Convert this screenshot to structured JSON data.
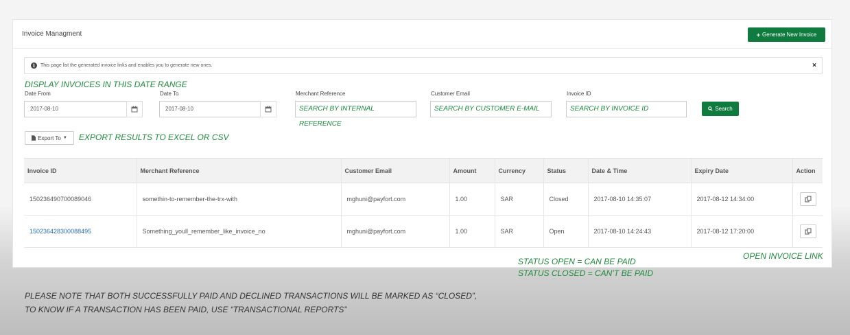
{
  "header": {
    "title": "Invoice Managment",
    "generate_button": "Generate New Invoice"
  },
  "info": {
    "text": "This page list the generated invoice links and enables you to generate new ones.",
    "close": "×"
  },
  "filters": {
    "annotation": "DISPLAY INVOICES IN THIS DATE RANGE",
    "date_from_label": "Date From",
    "date_from_value": "2017-08-10",
    "date_to_label": "Date To",
    "date_to_value": "2017-08-10",
    "merchant_ref_label": "Merchant Reference",
    "merchant_ref_hint": "SEARCH BY INTERNAL REFERENCE",
    "email_label": "Customer Email",
    "email_hint": "SEARCH BY CUSTOMER E-MAIL",
    "invoice_id_label": "Invoice ID",
    "invoice_id_hint": "SEARCH BY INVOICE ID",
    "search_button": "Search"
  },
  "export": {
    "button": "Export To",
    "annotation": "EXPORT RESULTS TO EXCEL OR CSV"
  },
  "table": {
    "headers": [
      "Invoice ID",
      "Merchant Reference",
      "Customer Email",
      "Amount",
      "Currency",
      "Status",
      "Date & Time",
      "Expiry Date",
      "Action"
    ],
    "rows": [
      {
        "invoice_id": "150236490700089046",
        "merchant_ref": "somethin-to-remember-the-trx-with",
        "email": "mghuni@payfort.com",
        "amount": "1.00",
        "currency": "SAR",
        "status": "Closed",
        "datetime": "2017-08-10 14:35:07",
        "expiry": "2017-08-12 14:34:00"
      },
      {
        "invoice_id": "150236428300088495",
        "merchant_ref": "Something_youll_remember_like_invoice_no",
        "email": "mghuni@payfort.com",
        "amount": "1.00",
        "currency": "SAR",
        "status": "Open",
        "datetime": "2017-08-10 14:24:43",
        "expiry": "2017-08-12 17:20:00"
      }
    ]
  },
  "annotations": {
    "status_open": "STATUS OPEN = CAN BE PAID",
    "status_closed": "STATUS CLOSED = CAN’T BE PAID",
    "open_link": "OPEN INVOICE LINK"
  },
  "note": {
    "line1": "PLEASE NOTE THAT BOTH SUCCESSFULLY PAID AND DECLINED TRANSACTIONS WILL BE MARKED AS “CLOSED”,",
    "line2": "TO KNOW IF A TRANSACTION HAS BEEN PAID, USE “TRANSACTIONAL REPORTS”"
  },
  "colors": {
    "accent": "#0f7b3e",
    "annotation": "#1f8a3d",
    "link": "#2a6db5"
  }
}
